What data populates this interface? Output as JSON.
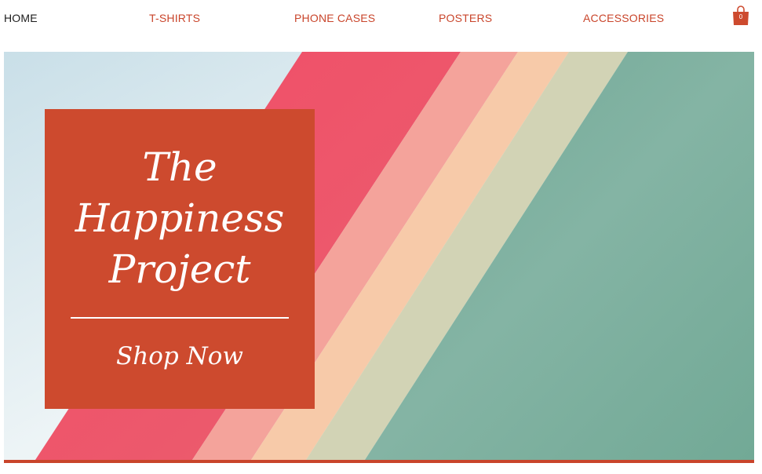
{
  "nav": {
    "items": [
      {
        "label": "HOME"
      },
      {
        "label": "T-SHIRTS"
      },
      {
        "label": "PHONE CASES"
      },
      {
        "label": "POSTERS"
      },
      {
        "label": "ACCESSORIES"
      }
    ],
    "cart_count": "0",
    "cart_icon": "shopping-bag-icon"
  },
  "hero": {
    "title_line1": "The",
    "title_line2": "Happiness",
    "title_line3": "Project",
    "cta_label": "Shop Now"
  },
  "colors": {
    "accent": "#cd4a2e",
    "nav_text": "#c9452b",
    "nav_active": "#1c1c1c",
    "stripe_red": "#f0506a",
    "stripe_pink": "#f4a09a",
    "stripe_peach": "#f6c8a8",
    "stripe_sage": "#cfd1b4",
    "teal": "#7aae9c",
    "sky": "#dbe9ef"
  }
}
